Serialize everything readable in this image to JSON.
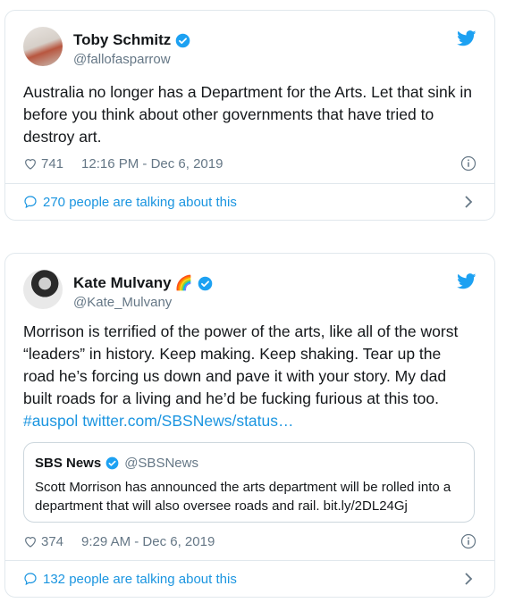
{
  "tweets": [
    {
      "name": "Toby Schmitz",
      "handle": "@fallofasparrow",
      "text": "Australia no longer has a Department for the Arts. Let that sink in before you think about other governments that have tried to destroy art.",
      "likes": "741",
      "timestamp": "12:16 PM - Dec 6, 2019",
      "talking": "270 people are talking about this"
    },
    {
      "name": "Kate Mulvany",
      "name_emoji": "🌈",
      "handle": "@Kate_Mulvany",
      "text_lines": [
        "Morrison is terrified of the power of the arts, like all of the worst",
        "“leaders” in history. Keep making. Keep shaking. Tear up the",
        "road he’s forcing us down and pave it with your story. My dad",
        "built roads for a living and he’d be fucking furious at this too."
      ],
      "hashtag": "#auspol",
      "link": "twitter.com/SBSNews/status…",
      "quote": {
        "name": "SBS News",
        "handle": "@SBSNews",
        "text": "Scott Morrison has announced the arts department will be rolled into a department that will also oversee roads and rail. bit.ly/2DL24Gj"
      },
      "likes": "374",
      "timestamp": "9:29 AM - Dec 6, 2019",
      "talking": "132 people are talking about this"
    }
  ],
  "colors": {
    "accent": "#1da1f2",
    "link": "#1b95e0",
    "muted": "#657786",
    "border": "#e1e8ed"
  },
  "icons": [
    "verified-badge-icon",
    "twitter-bird-icon",
    "heart-icon",
    "info-icon",
    "speech-bubble-icon",
    "chevron-right-icon"
  ]
}
